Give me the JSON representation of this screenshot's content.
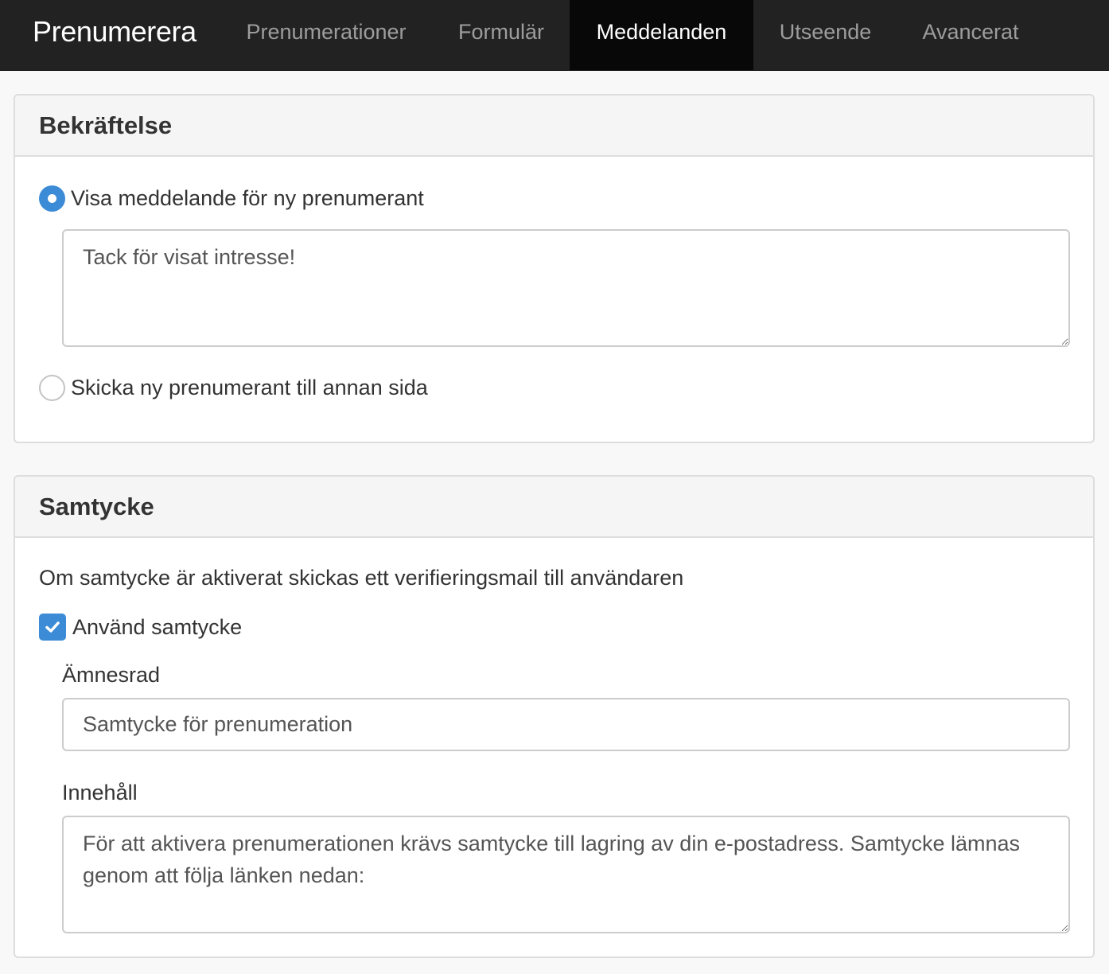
{
  "navbar": {
    "brand": "Prenumerera",
    "tabs": [
      {
        "label": "Prenumerationer",
        "active": false
      },
      {
        "label": "Formulär",
        "active": false
      },
      {
        "label": "Meddelanden",
        "active": true
      },
      {
        "label": "Utseende",
        "active": false
      },
      {
        "label": "Avancerat",
        "active": false
      }
    ]
  },
  "confirmation": {
    "title": "Bekräftelse",
    "option_message": {
      "label": "Visa meddelande för ny prenumerant",
      "selected": true
    },
    "message_text": "Tack för visat intresse!",
    "option_redirect": {
      "label": "Skicka ny prenumerant till annan sida",
      "selected": false
    }
  },
  "consent": {
    "title": "Samtycke",
    "help_text": "Om samtycke är aktiverat skickas ett verifieringsmail till användaren",
    "use_consent": {
      "label": "Använd samtycke",
      "checked": true
    },
    "subject": {
      "label": "Ämnesrad",
      "value": "Samtycke för prenumeration"
    },
    "content": {
      "label": "Innehåll",
      "value": "För att aktivera prenumerationen krävs samtycke till lagring av din e-postadress. Samtycke lämnas genom att följa länken nedan:"
    }
  },
  "colors": {
    "navbar_bg": "#222222",
    "active_tab_bg": "#080808",
    "accent": "#3c8bd6"
  }
}
